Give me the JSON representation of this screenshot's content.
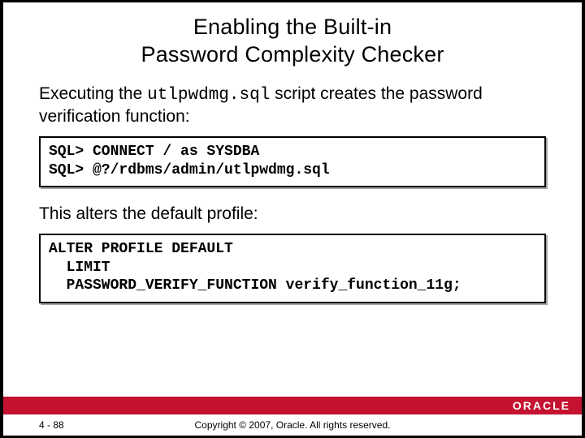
{
  "slide": {
    "title_line1": "Enabling the Built-in",
    "title_line2": "Password Complexity Checker",
    "intro_prefix": "Executing the ",
    "intro_code": "utlpwdmg.sql",
    "intro_suffix": " script creates the password verification function:",
    "code1_line1": "SQL> CONNECT / as SYSDBA",
    "code1_line2": "SQL> @?/rdbms/admin/utlpwdmg.sql",
    "mid_text": "This alters the default profile:",
    "code2_line1": "ALTER PROFILE DEFAULT",
    "code2_line2": "  LIMIT",
    "code2_line3": "  PASSWORD_VERIFY_FUNCTION verify_function_11g;"
  },
  "footer": {
    "page": "4 - 88",
    "copyright": "Copyright © 2007, Oracle. All rights reserved.",
    "logo_text": "ORACLE"
  }
}
